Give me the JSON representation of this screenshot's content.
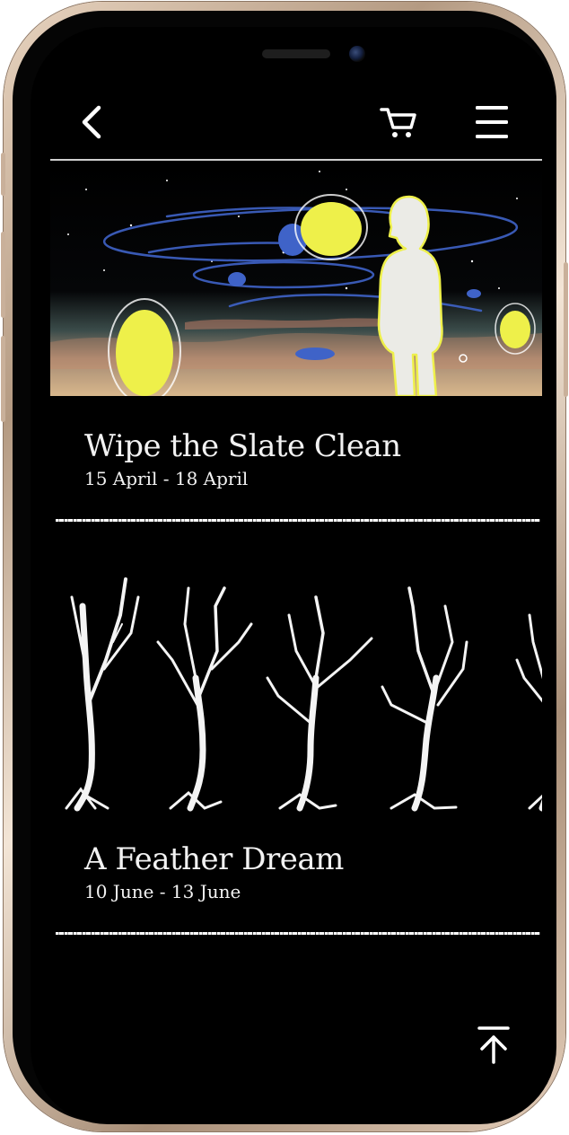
{
  "header": {
    "back_icon": "back-arrow-icon",
    "cart_icon": "cart-icon",
    "menu_icon": "hamburger-menu-icon"
  },
  "exhibitions": [
    {
      "title": "Wipe the Slate Clean",
      "dates": "15 April - 18 April",
      "artwork": "figure-with-yellow-orbs-artwork"
    },
    {
      "title": "A Feather Dream",
      "dates": "10 June - 13 June",
      "artwork": "white-trees-artwork"
    }
  ],
  "footer": {
    "back_to_top_icon": "arrow-up-to-top-icon"
  },
  "colors": {
    "background": "#000000",
    "text": "#f2f2f2",
    "accent_yellow": "#eef04a",
    "accent_blue": "#3f63c8",
    "device_frame": "#d8c2ad"
  }
}
